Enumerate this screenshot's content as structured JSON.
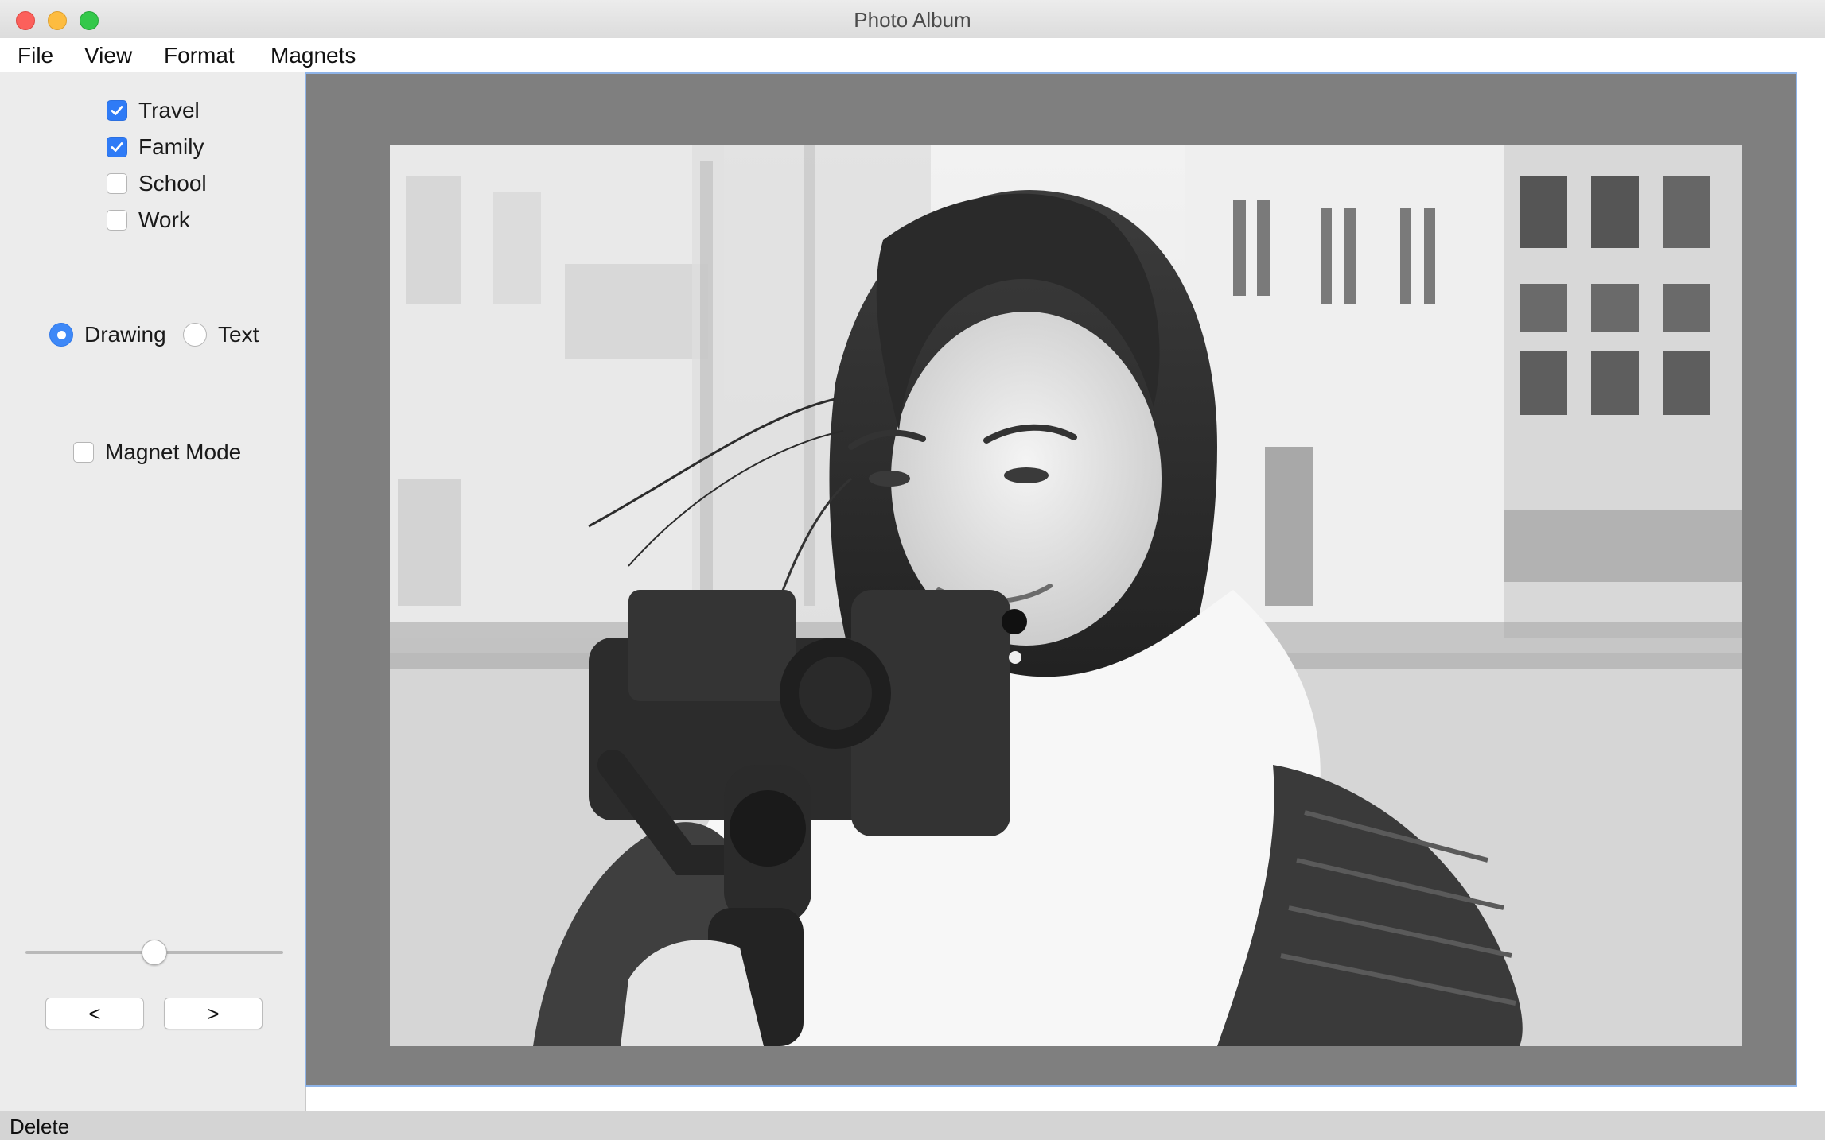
{
  "window": {
    "title": "Photo Album"
  },
  "menu": {
    "items": [
      "File",
      "View",
      "Format",
      "Magnets"
    ]
  },
  "tags": [
    {
      "label": "Travel",
      "checked": true
    },
    {
      "label": "Family",
      "checked": true
    },
    {
      "label": "School",
      "checked": false
    },
    {
      "label": "Work",
      "checked": false
    }
  ],
  "mode": {
    "drawing_label": "Drawing",
    "text_label": "Text",
    "selected": "Drawing"
  },
  "magnet_mode": {
    "label": "Magnet Mode",
    "checked": false
  },
  "slider": {
    "value_fraction": 0.5
  },
  "nav": {
    "prev_label": "<",
    "next_label": ">"
  },
  "status": {
    "text": "Delete"
  },
  "colors": {
    "accent": "#2f7bf6",
    "canvas_background": "#7f7f7f",
    "close": "#fc605b",
    "minimize": "#fdbc40",
    "maximize": "#34c84a"
  }
}
